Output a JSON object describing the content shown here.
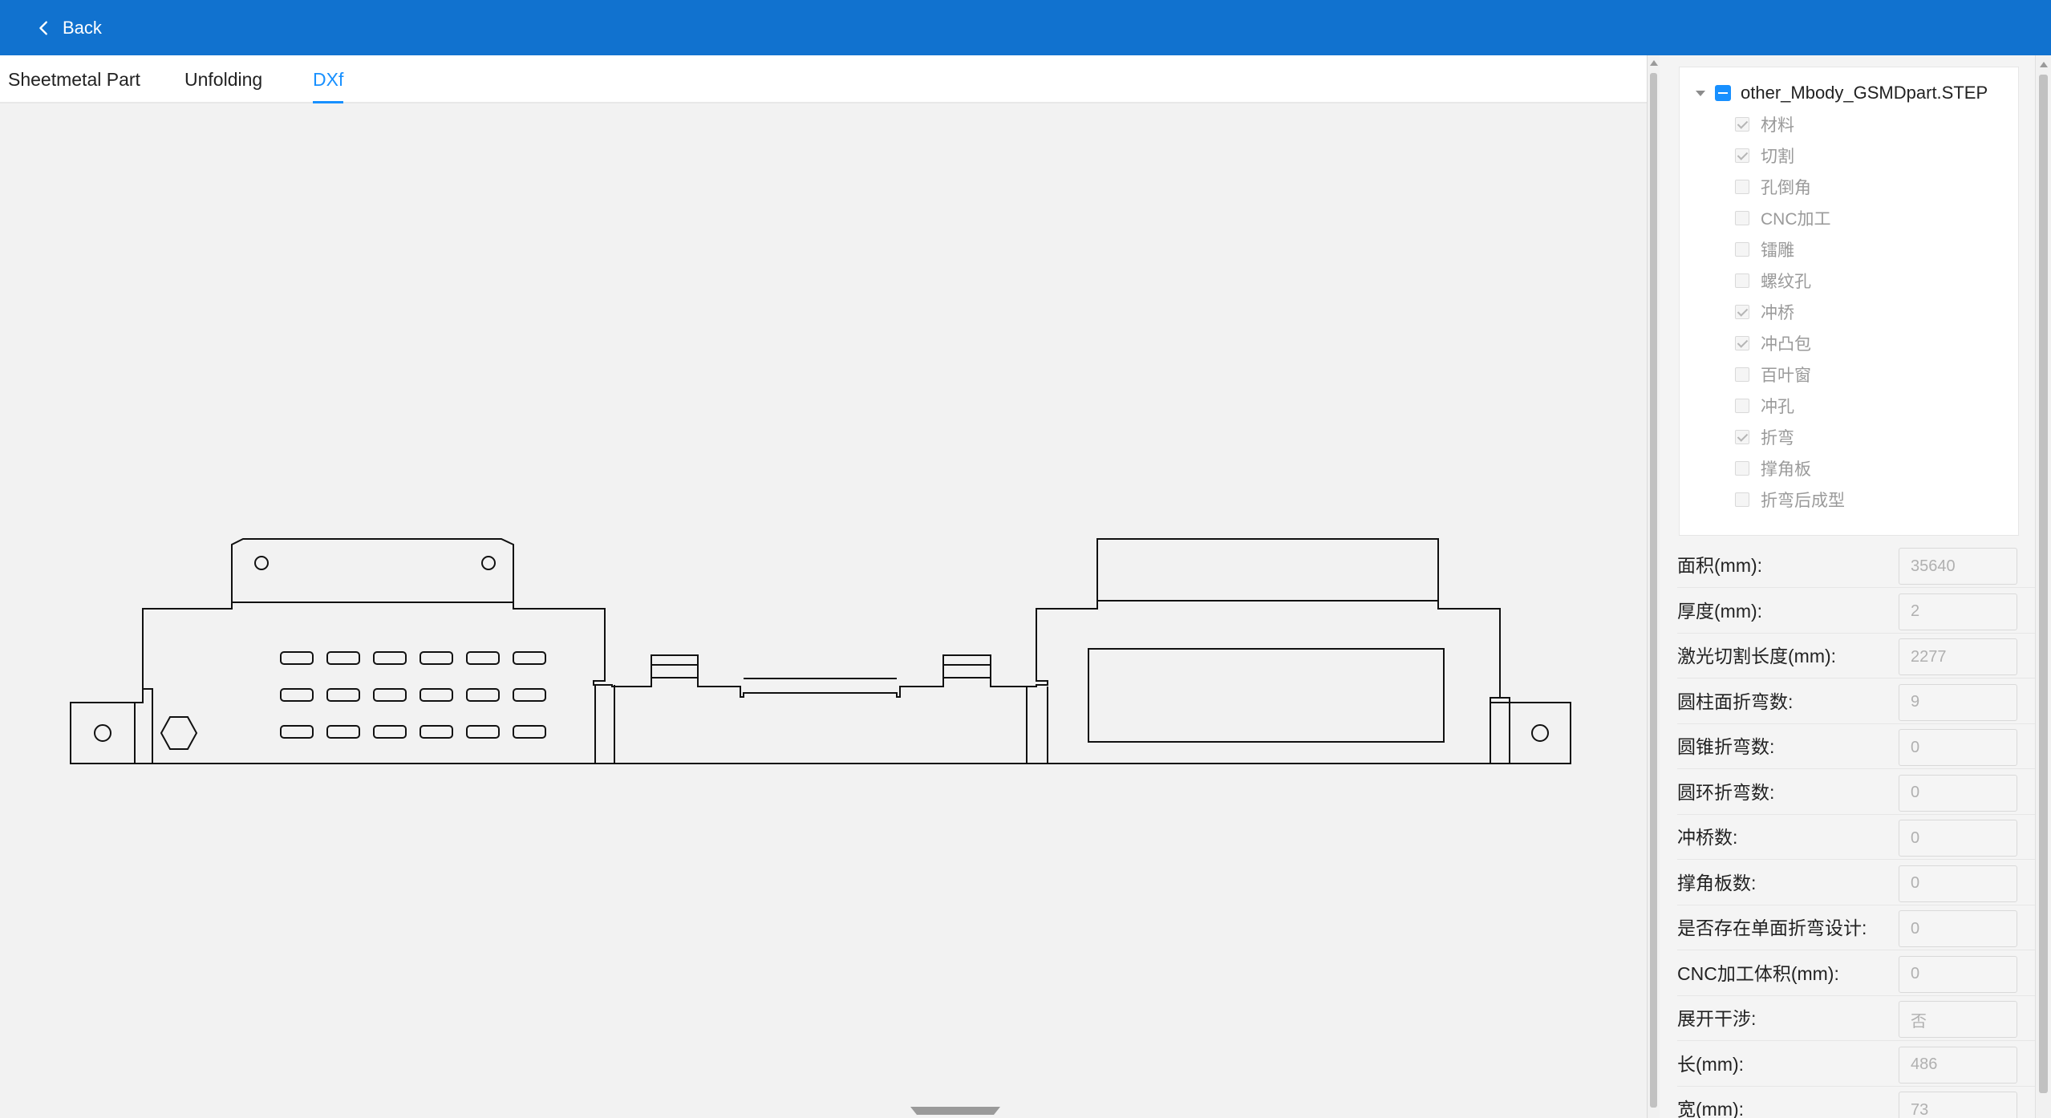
{
  "header": {
    "back_label": "Back",
    "back_icon": "chevron-left-icon",
    "bar_color": "#1172cf"
  },
  "tabs": [
    {
      "label": "Sheetmetal Part",
      "active": false
    },
    {
      "label": "Unfolding",
      "active": false
    },
    {
      "label": "DXf",
      "active": true
    }
  ],
  "accent_color": "#1890ff",
  "tree": {
    "root_label": "other_Mbody_GSMDpart.STEP",
    "items": [
      {
        "label": "材料",
        "checked": true
      },
      {
        "label": "切割",
        "checked": true
      },
      {
        "label": "孔倒角",
        "checked": false
      },
      {
        "label": "CNC加工",
        "checked": false
      },
      {
        "label": "镭雕",
        "checked": false
      },
      {
        "label": "螺纹孔",
        "checked": false
      },
      {
        "label": "冲桥",
        "checked": true
      },
      {
        "label": "冲凸包",
        "checked": true
      },
      {
        "label": "百叶窗",
        "checked": false
      },
      {
        "label": "冲孔",
        "checked": false
      },
      {
        "label": "折弯",
        "checked": true
      },
      {
        "label": "撑角板",
        "checked": false
      },
      {
        "label": "折弯后成型",
        "checked": false
      }
    ]
  },
  "properties": [
    {
      "label": "面积(mm):",
      "value": "35640"
    },
    {
      "label": "厚度(mm):",
      "value": "2"
    },
    {
      "label": "激光切割长度(mm):",
      "value": "2277"
    },
    {
      "label": "圆柱面折弯数:",
      "value": "9"
    },
    {
      "label": "圆锥折弯数:",
      "value": "0"
    },
    {
      "label": "圆环折弯数:",
      "value": "0"
    },
    {
      "label": "冲桥数:",
      "value": "0"
    },
    {
      "label": "撑角板数:",
      "value": "0"
    },
    {
      "label": "是否存在单面折弯设计:",
      "value": "0"
    },
    {
      "label": "CNC加工体积(mm):",
      "value": "0"
    },
    {
      "label": "展开干涉:",
      "value": "否"
    },
    {
      "label": "长(mm):",
      "value": "486"
    },
    {
      "label": "宽(mm):",
      "value": "73"
    }
  ]
}
